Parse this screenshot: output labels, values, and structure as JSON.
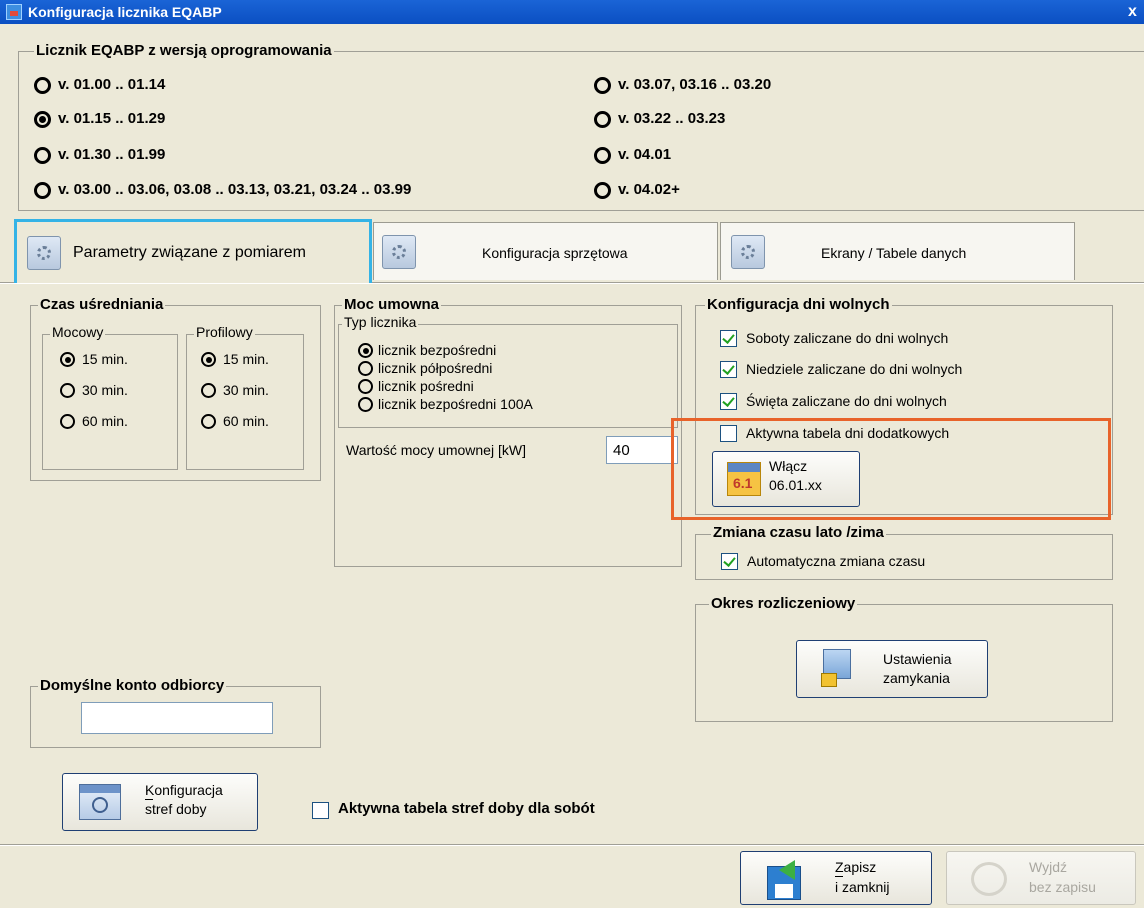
{
  "window": {
    "title": "Konfiguracja licznika EQABP",
    "close": "x"
  },
  "version_group": {
    "title": "Licznik EQABP z wersją oprogramowania",
    "options": [
      {
        "label": "v. 01.00 .. 01.14",
        "selected": false
      },
      {
        "label": "v. 01.15 .. 01.29",
        "selected": true
      },
      {
        "label": "v. 01.30 .. 01.99",
        "selected": false
      },
      {
        "label": "v. 03.00 .. 03.06, 03.08 .. 03.13, 03.21, 03.24 .. 03.99",
        "selected": false
      },
      {
        "label": "v. 03.07, 03.16 .. 03.20",
        "selected": false
      },
      {
        "label": "v. 03.22 .. 03.23",
        "selected": false
      },
      {
        "label": "v. 04.01",
        "selected": false
      },
      {
        "label": "v. 04.02+",
        "selected": false
      }
    ]
  },
  "tabs": [
    {
      "label": "Parametry związane z pomiarem",
      "active": true
    },
    {
      "label": "Konfiguracja sprzętowa",
      "active": false
    },
    {
      "label": "Ekrany / Tabele danych",
      "active": false
    }
  ],
  "averaging": {
    "title": "Czas uśredniania",
    "mocowy": {
      "title": "Mocowy",
      "options": [
        "15 min.",
        "30 min.",
        "60 min."
      ],
      "selected": 0
    },
    "profilowy": {
      "title": "Profilowy",
      "options": [
        "15 min.",
        "30 min.",
        "60 min."
      ],
      "selected": 0
    }
  },
  "contract_power": {
    "title": "Moc umowna",
    "meter_type": {
      "title": "Typ licznika",
      "options": [
        "licznik bezpośredni",
        "licznik półpośredni",
        "licznik pośredni",
        "licznik bezpośredni 100A"
      ],
      "selected": 0
    },
    "value_label": "Wartość mocy umownej [kW]",
    "value": "40"
  },
  "free_days": {
    "title": "Konfiguracja dni wolnych",
    "checks": [
      {
        "label": "Soboty zaliczane do dni wolnych",
        "checked": true
      },
      {
        "label": "Niedziele zaliczane do dni wolnych",
        "checked": true
      },
      {
        "label": "Święta zaliczane do dni wolnych",
        "checked": true
      },
      {
        "label": "Aktywna tabela dni dodatkowych",
        "checked": false
      }
    ],
    "enable_button": {
      "line1": "Włącz",
      "line2": "06.01.xx"
    },
    "highlight_color": "#e8632a"
  },
  "dst": {
    "title": "Zmiana czasu lato /zima",
    "check": {
      "label": "Automatyczna zmiana czasu",
      "checked": true
    }
  },
  "billing": {
    "title": "Okres rozliczeniowy",
    "button": {
      "line1": "Ustawienia",
      "line2": "zamykania"
    }
  },
  "default_account": {
    "title": "Domyślne konto odbiorcy",
    "value": ""
  },
  "zones_button": {
    "line1": "Konfiguracja",
    "line2": "stref doby"
  },
  "saturday_zones": {
    "label": "Aktywna tabela stref doby dla sobót",
    "checked": false
  },
  "footer": {
    "save": {
      "line1": "Zapisz",
      "line2": "i zamknij"
    },
    "exit": {
      "line1": "Wyjdź",
      "line2": "bez zapisu"
    }
  },
  "colors": {
    "titlebar": "#0b4fc2",
    "active_tab_border": "#34b3e6",
    "dialog_bg": "#ece9d8"
  }
}
